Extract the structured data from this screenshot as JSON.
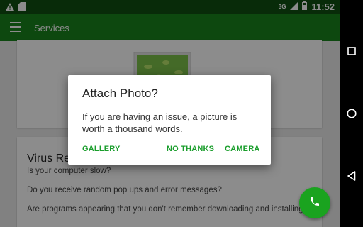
{
  "status_bar": {
    "network": "3G",
    "time": "11:52"
  },
  "app_bar": {
    "title": "Services"
  },
  "background": {
    "virus_card": {
      "title": "Virus Re",
      "questions": [
        "Is your computer slow?",
        "Do you receive random pop ups and error messages?",
        "Are programs appearing that you don't remember downloading and installing?"
      ]
    }
  },
  "dialog": {
    "title": "Attach Photo?",
    "message": "If you are having an issue, a picture is worth a thousand words.",
    "buttons": {
      "gallery": "GALLERY",
      "no_thanks": "NO THANKS",
      "camera": "CAMERA"
    }
  },
  "colors": {
    "primary": "#19831d",
    "primary_dark": "#0f4f12",
    "accent": "#1a9e2c",
    "fab": "#1aa31f"
  },
  "icons": {
    "menu": "hamburger-icon",
    "fab": "phone-icon",
    "nav_back": "back-triangle-icon",
    "nav_home": "home-circle-icon",
    "nav_recents": "recents-square-icon"
  }
}
